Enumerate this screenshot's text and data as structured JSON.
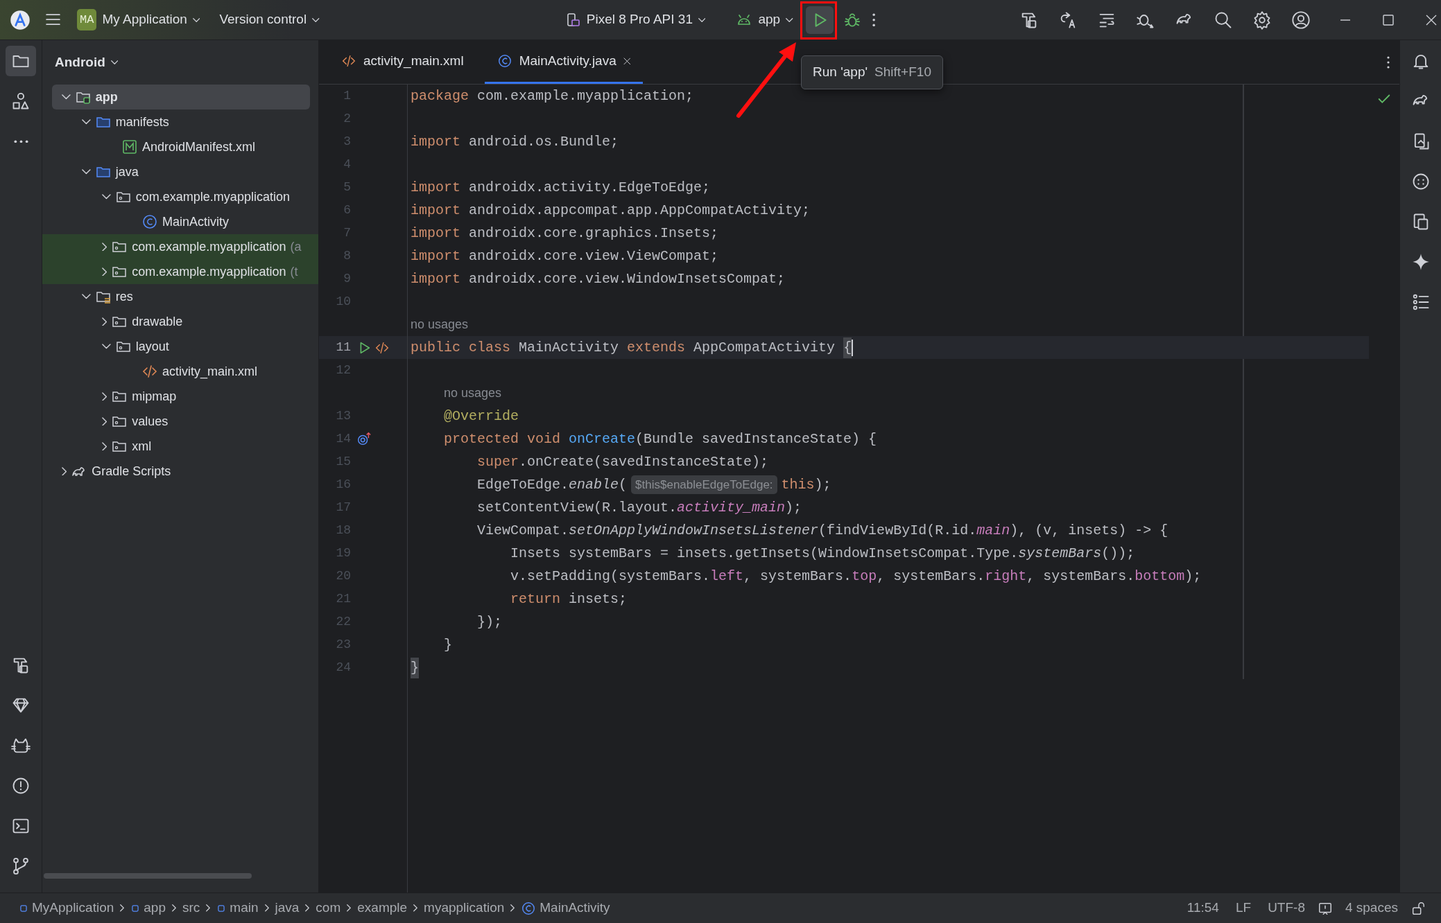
{
  "title_bar": {
    "project_badge": "MA",
    "project": "My Application",
    "vcs": "Version control",
    "device": "Pixel 8 Pro API 31",
    "run_config": "app"
  },
  "tooltip": {
    "label": "Run 'app'",
    "shortcut": "Shift+F10"
  },
  "project_panel": {
    "view": "Android",
    "tree": [
      {
        "label": "app",
        "kind": "module",
        "expanded": true,
        "selected": true,
        "highlighted": false,
        "children": [
          {
            "label": "manifests",
            "kind": "folder",
            "expanded": true,
            "selected": false,
            "highlighted": false,
            "children": [
              {
                "label": "AndroidManifest.xml",
                "kind": "manifest",
                "selected": false,
                "highlighted": false
              }
            ]
          },
          {
            "label": "java",
            "kind": "folder",
            "expanded": true,
            "selected": false,
            "highlighted": false,
            "children": [
              {
                "label": "com.example.myapplication",
                "kind": "package",
                "expanded": true,
                "selected": false,
                "highlighted": false,
                "children": [
                  {
                    "label": "MainActivity",
                    "kind": "class",
                    "selected": false,
                    "highlighted": false
                  }
                ]
              },
              {
                "label": "com.example.myapplication",
                "suffix": "(a",
                "kind": "package",
                "expanded": false,
                "selected": false,
                "highlighted": true
              },
              {
                "label": "com.example.myapplication",
                "suffix": "(t",
                "kind": "package",
                "expanded": false,
                "selected": false,
                "highlighted": true
              }
            ]
          },
          {
            "label": "res",
            "kind": "res",
            "expanded": true,
            "selected": false,
            "highlighted": false,
            "children": [
              {
                "label": "drawable",
                "kind": "package",
                "expanded": false,
                "selected": false,
                "highlighted": false
              },
              {
                "label": "layout",
                "kind": "package",
                "expanded": true,
                "selected": false,
                "highlighted": false,
                "children": [
                  {
                    "label": "activity_main.xml",
                    "kind": "layout",
                    "selected": false,
                    "highlighted": false
                  }
                ]
              },
              {
                "label": "mipmap",
                "kind": "package",
                "expanded": false,
                "selected": false,
                "highlighted": false
              },
              {
                "label": "values",
                "kind": "package",
                "expanded": false,
                "selected": false,
                "highlighted": false
              },
              {
                "label": "xml",
                "kind": "package",
                "expanded": false,
                "selected": false,
                "highlighted": false
              }
            ]
          }
        ]
      },
      {
        "label": "Gradle Scripts",
        "kind": "gradle",
        "expanded": false,
        "selected": false,
        "highlighted": false
      }
    ]
  },
  "editor": {
    "tabs": [
      {
        "label": "activity_main.xml",
        "kind": "xml",
        "selected": false
      },
      {
        "label": "MainActivity.java",
        "kind": "class",
        "selected": true
      }
    ],
    "lines": [
      {
        "kind": "code",
        "number": "1",
        "current": false,
        "tokens": [
          {
            "kind": "keyword",
            "text": "package"
          },
          {
            "kind": "plain",
            "text": " com.example.myapplication;"
          }
        ]
      },
      {
        "kind": "code",
        "number": "2",
        "current": false
      },
      {
        "kind": "code",
        "number": "3",
        "current": false,
        "tokens": [
          {
            "kind": "keyword",
            "text": "import"
          },
          {
            "kind": "plain",
            "text": " android.os.Bundle;"
          }
        ]
      },
      {
        "kind": "code",
        "number": "4",
        "current": false
      },
      {
        "kind": "code",
        "number": "5",
        "current": false,
        "tokens": [
          {
            "kind": "keyword",
            "text": "import"
          },
          {
            "kind": "plain",
            "text": " androidx.activity.EdgeToEdge;"
          }
        ]
      },
      {
        "kind": "code",
        "number": "6",
        "current": false,
        "tokens": [
          {
            "kind": "keyword",
            "text": "import"
          },
          {
            "kind": "plain",
            "text": " androidx.appcompat.app.AppCompatActivity;"
          }
        ]
      },
      {
        "kind": "code",
        "number": "7",
        "current": false,
        "tokens": [
          {
            "kind": "keyword",
            "text": "import"
          },
          {
            "kind": "plain",
            "text": " androidx.core.graphics.Insets;"
          }
        ]
      },
      {
        "kind": "code",
        "number": "8",
        "current": false,
        "tokens": [
          {
            "kind": "keyword",
            "text": "import"
          },
          {
            "kind": "plain",
            "text": " androidx.core.view.ViewCompat;"
          }
        ]
      },
      {
        "kind": "code",
        "number": "9",
        "current": false,
        "tokens": [
          {
            "kind": "keyword",
            "text": "import"
          },
          {
            "kind": "plain",
            "text": " androidx.core.view.WindowInsetsCompat;"
          }
        ]
      },
      {
        "kind": "code",
        "number": "10",
        "current": false
      },
      {
        "kind": "usages",
        "text": "no usages"
      },
      {
        "kind": "runnable",
        "number": "11",
        "current": true,
        "tokens": [
          {
            "kind": "keyword",
            "text": "public class"
          },
          {
            "kind": "plain",
            "text": " MainActivity "
          },
          {
            "kind": "keyword",
            "text": "extends"
          },
          {
            "kind": "plain",
            "text": " AppCompatActivity "
          },
          {
            "kind": "brace",
            "text": "{"
          }
        ]
      },
      {
        "kind": "code",
        "number": "12",
        "current": false
      },
      {
        "kind": "usages",
        "text": "    no usages"
      },
      {
        "kind": "code",
        "number": "13",
        "current": false,
        "tokens": [
          {
            "kind": "annotation",
            "text": "    @Override"
          }
        ]
      },
      {
        "kind": "override",
        "number": "14",
        "current": false,
        "tokens": [
          {
            "kind": "keyword",
            "text": "    protected void "
          },
          {
            "kind": "declaration",
            "text": "onCreate"
          },
          {
            "kind": "plain",
            "text": "(Bundle savedInstanceState) {"
          }
        ]
      },
      {
        "kind": "code",
        "number": "15",
        "current": false,
        "tokens": [
          {
            "kind": "keyword",
            "text": "        super"
          },
          {
            "kind": "plain",
            "text": ".onCreate(savedInstanceState);"
          }
        ]
      },
      {
        "kind": "code",
        "number": "16",
        "current": false,
        "tokens": [
          {
            "kind": "plain",
            "text": "        EdgeToEdge."
          },
          {
            "kind": "static_method",
            "text": "enable"
          },
          {
            "kind": "plain",
            "text": "("
          },
          {
            "kind": "hint",
            "text": "$this$enableEdgeToEdge:"
          },
          {
            "kind": "keyword",
            "text": "this"
          },
          {
            "kind": "plain",
            "text": ");"
          }
        ]
      },
      {
        "kind": "code",
        "number": "17",
        "current": false,
        "tokens": [
          {
            "kind": "plain",
            "text": "        setContentView(R.layout."
          },
          {
            "kind": "static_field",
            "text": "activity_main"
          },
          {
            "kind": "plain",
            "text": ");"
          }
        ]
      },
      {
        "kind": "code",
        "number": "18",
        "current": false,
        "tokens": [
          {
            "kind": "plain",
            "text": "        ViewCompat."
          },
          {
            "kind": "static_method",
            "text": "setOnApplyWindowInsetsListener"
          },
          {
            "kind": "plain",
            "text": "(findViewById(R.id."
          },
          {
            "kind": "static_field",
            "text": "main"
          },
          {
            "kind": "plain",
            "text": "), (v, insets) -> {"
          }
        ]
      },
      {
        "kind": "code",
        "number": "19",
        "current": false,
        "tokens": [
          {
            "kind": "plain",
            "text": "            Insets systemBars = insets.getInsets(WindowInsetsCompat.Type."
          },
          {
            "kind": "static_method",
            "text": "systemBars"
          },
          {
            "kind": "plain",
            "text": "());"
          }
        ]
      },
      {
        "kind": "code",
        "number": "20",
        "current": false,
        "tokens": [
          {
            "kind": "plain",
            "text": "            v.setPadding(systemBars."
          },
          {
            "kind": "field",
            "text": "left"
          },
          {
            "kind": "plain",
            "text": ", systemBars."
          },
          {
            "kind": "field",
            "text": "top"
          },
          {
            "kind": "plain",
            "text": ", systemBars."
          },
          {
            "kind": "field",
            "text": "right"
          },
          {
            "kind": "plain",
            "text": ", systemBars."
          },
          {
            "kind": "field",
            "text": "bottom"
          },
          {
            "kind": "plain",
            "text": ");"
          }
        ]
      },
      {
        "kind": "code",
        "number": "21",
        "current": false,
        "tokens": [
          {
            "kind": "keyword",
            "text": "            return"
          },
          {
            "kind": "plain",
            "text": " insets;"
          }
        ]
      },
      {
        "kind": "code",
        "number": "22",
        "current": false,
        "tokens": [
          {
            "kind": "plain",
            "text": "        });"
          }
        ]
      },
      {
        "kind": "code",
        "number": "23",
        "current": false,
        "tokens": [
          {
            "kind": "plain",
            "text": "    }"
          }
        ]
      },
      {
        "kind": "code",
        "number": "24",
        "current": false,
        "tokens": [
          {
            "kind": "brace",
            "text": "}"
          }
        ]
      }
    ]
  },
  "status_bar": {
    "breadcrumbs": [
      {
        "label": "MyApplication",
        "kind": "module"
      },
      {
        "label": "app",
        "kind": "module"
      },
      {
        "label": "src",
        "kind": "plain"
      },
      {
        "label": "main",
        "kind": "module"
      },
      {
        "label": "java",
        "kind": "plain"
      },
      {
        "label": "com",
        "kind": "plain"
      },
      {
        "label": "example",
        "kind": "plain"
      },
      {
        "label": "myapplication",
        "kind": "plain"
      },
      {
        "label": "MainActivity",
        "kind": "class"
      }
    ],
    "position": "11:54",
    "line_separator": "LF",
    "encoding": "UTF-8",
    "indent": "4 spaces"
  }
}
